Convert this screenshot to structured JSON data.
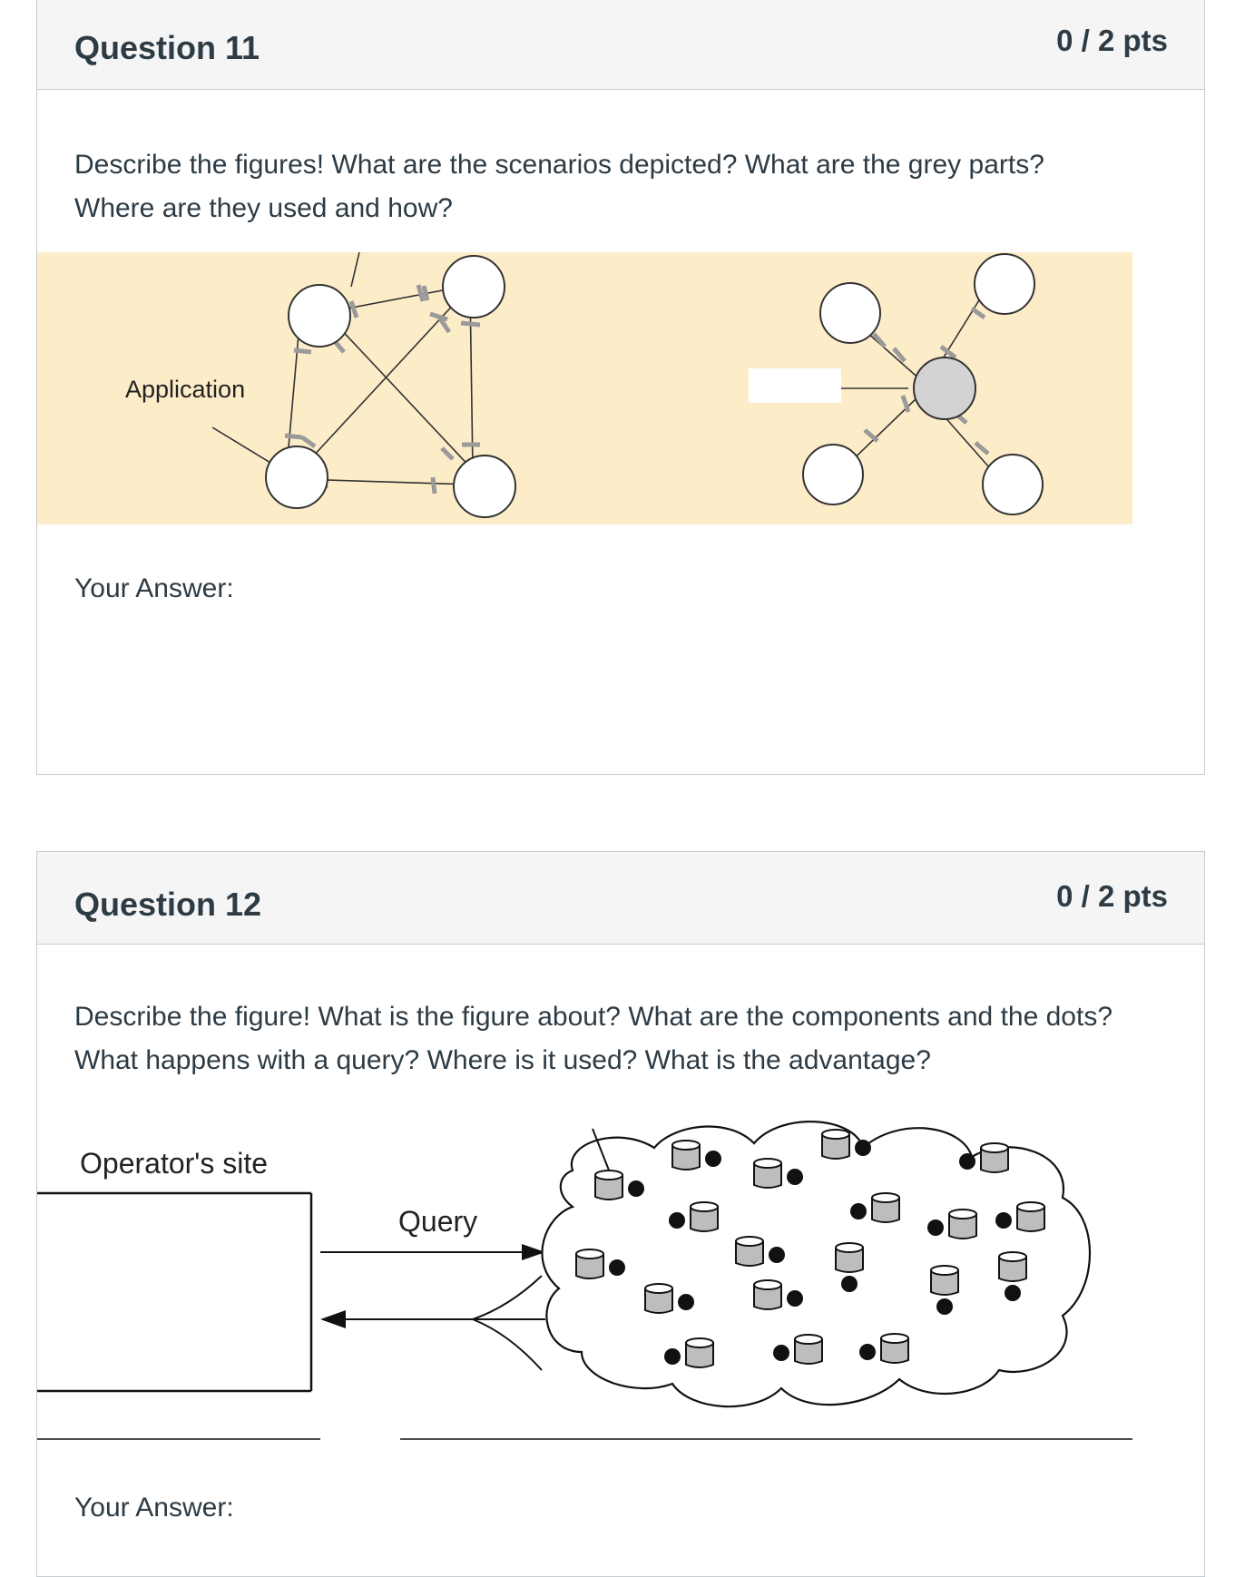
{
  "q11": {
    "title": "Question 11",
    "points": "0 / 2 pts",
    "text_line1": "Describe the figures! What are the scenarios depicted? What are the grey parts?",
    "text_line2": "Where are they used and how?",
    "figure_label": "Application",
    "answer_label": "Your Answer:",
    "figure_bg": "#fdecc8",
    "hub_color": "#d3d3d3"
  },
  "q12": {
    "title": "Question 12",
    "points": "0 / 2 pts",
    "text_line1": "Describe the figure! What is the figure about? What are the components and the dots?",
    "text_line2": "What happens with a query? Where is it used? What is the advantage?",
    "operator_label": "Operator's site",
    "query_label": "Query",
    "answer_label": "Your Answer:"
  }
}
